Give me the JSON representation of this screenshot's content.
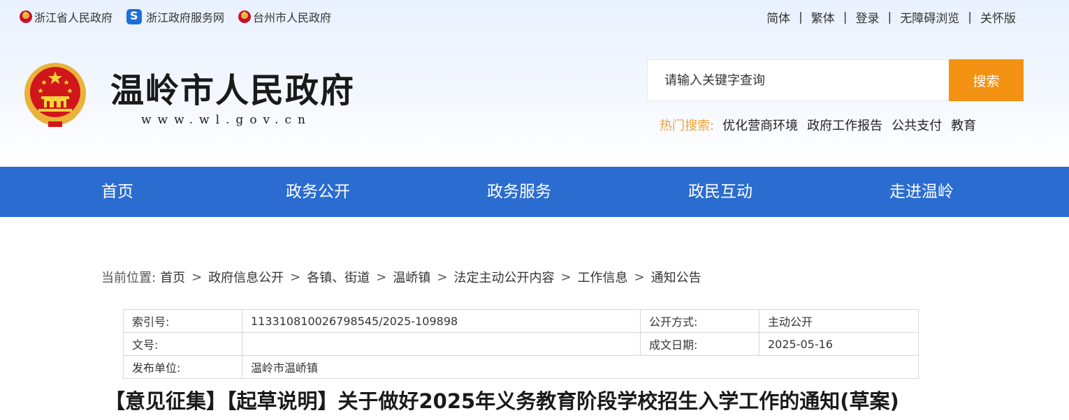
{
  "top_links": [
    {
      "label": "浙江省人民政府",
      "icon": "emblem-icon"
    },
    {
      "label": "浙江政府服务网",
      "icon": "service-icon"
    },
    {
      "label": "台州市人民政府",
      "icon": "emblem-icon"
    }
  ],
  "top_right": [
    "简体",
    "繁体",
    "登录",
    "无障碍浏览",
    "关怀版"
  ],
  "separator": "|",
  "header": {
    "title": "温岭市人民政府",
    "url": "www.wl.gov.cn"
  },
  "search": {
    "placeholder": "请输入关键字查询",
    "button": "搜索",
    "hot_label": "热门搜索:",
    "hot_items": [
      "优化营商环境",
      "政府工作报告",
      "公共支付",
      "教育"
    ]
  },
  "nav": [
    "首页",
    "政务公开",
    "政务服务",
    "政民互动",
    "走进温岭"
  ],
  "breadcrumb": {
    "prefix": "当前位置:",
    "items": [
      "首页",
      "政府信息公开",
      "各镇、街道",
      "温峤镇",
      "法定主动公开内容",
      "工作信息",
      "通知公告"
    ],
    "sep": ">"
  },
  "meta": {
    "index_label": "索引号:",
    "index_value": "113310810026798545/2025-109898",
    "open_label": "公开方式:",
    "open_value": "主动公开",
    "doc_label": "文号:",
    "doc_value": "",
    "date_label": "成文日期:",
    "date_value": "2025-05-16",
    "issuer_label": "发布单位:",
    "issuer_value": "温岭市温峤镇"
  },
  "article_title": "【意见征集】【起草说明】关于做好2025年义务教育阶段学校招生入学工作的通知(草案)",
  "colors": {
    "nav_bg": "#2b6cd0",
    "search_button": "#f39212",
    "hot_label": "#f0a23c"
  }
}
